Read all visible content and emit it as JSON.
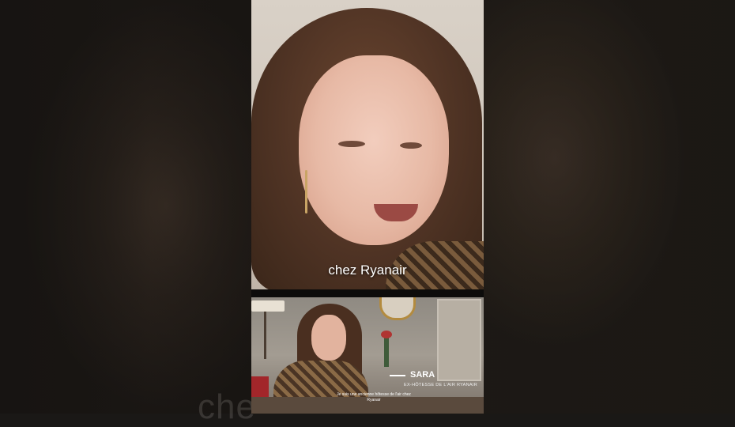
{
  "video": {
    "caption": "chez Ryanair",
    "ghost_caption": "che",
    "lower_third": {
      "name": "SARA",
      "role": "EX-HÔTESSE DE L'AIR RYANAIR"
    },
    "inset_subtitle": "Je suis une ancienne hôtesse de l'air chez Ryanair"
  },
  "colors": {
    "background": "#1a1816",
    "caption_text": "#ffffff",
    "divider": "#0d0c0b"
  }
}
